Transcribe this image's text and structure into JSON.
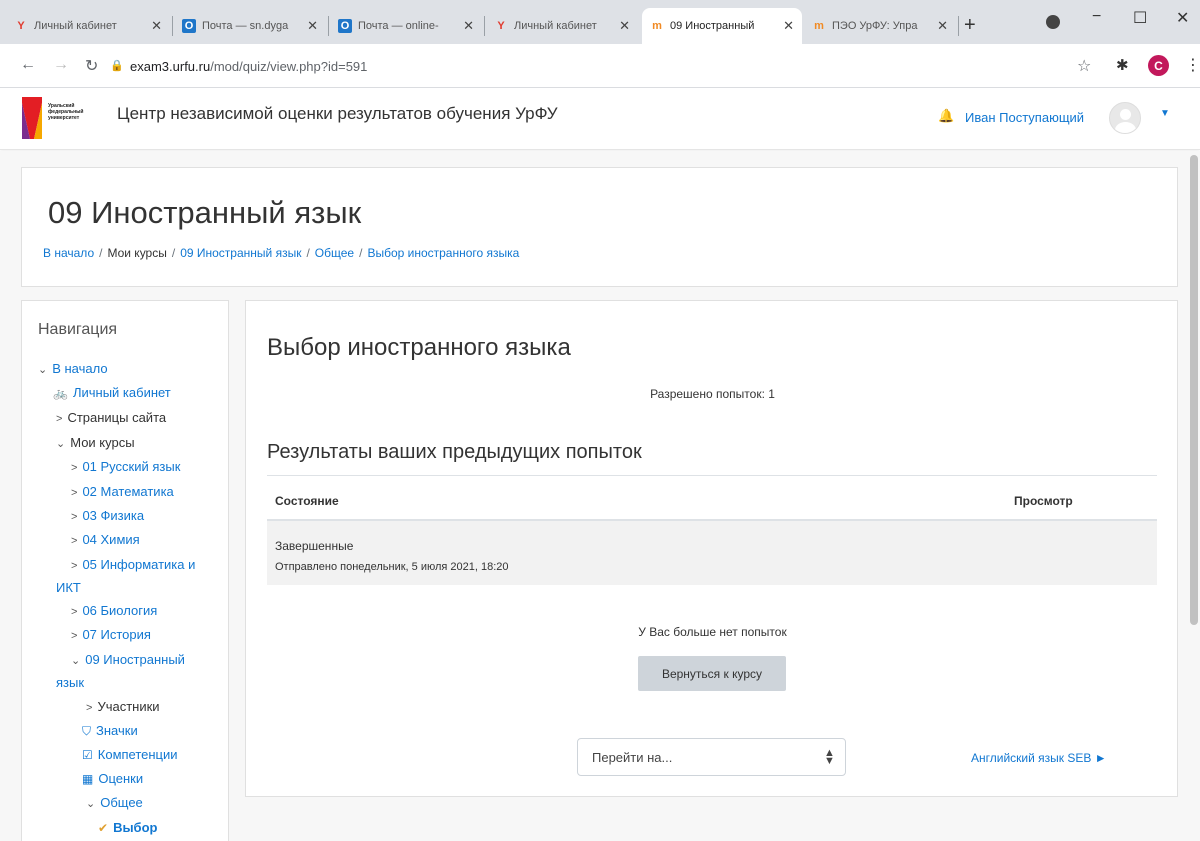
{
  "browser": {
    "tabs": [
      {
        "title": "Личный кабинет",
        "favicon": "yandex-icon"
      },
      {
        "title": "Почта — sn.dyga",
        "favicon": "outlook-icon"
      },
      {
        "title": "Почта — online-",
        "favicon": "outlook-icon"
      },
      {
        "title": "Личный кабинет",
        "favicon": "yandex-icon"
      },
      {
        "title": "09 Иностранный",
        "favicon": "moodle-icon",
        "active": true
      },
      {
        "title": "ПЭО УрФУ: Упра",
        "favicon": "moodle-icon"
      }
    ],
    "new_tab": "+",
    "url_host": "exam3.urfu.ru",
    "url_path": "/mod/quiz/view.php?id=591",
    "profile_letter": "C",
    "window_controls": {
      "minimize": "−",
      "maximize": "☐",
      "close": "✕"
    }
  },
  "site": {
    "logo_text": [
      "Уральский",
      "федеральный",
      "университет"
    ],
    "title": "Центр независимой оценки результатов обучения УрФУ",
    "user_name": "Иван Поступающий"
  },
  "course": {
    "title": "09 Иностранный язык",
    "breadcrumb": [
      "В начало",
      "Мои курсы",
      "09 Иностранный язык",
      "Общее",
      "Выбор иностранного языка"
    ]
  },
  "navigation": {
    "title": "Навигация",
    "items": [
      {
        "label": "В начало",
        "chevron": "⌄"
      },
      {
        "label": "Личный кабинет",
        "icon": "dashboard-icon"
      },
      {
        "label": "Страницы сайта",
        "chevron": ">"
      },
      {
        "label": "Мои курсы",
        "chevron": "⌄"
      },
      {
        "label": "01 Русский язык",
        "chevron": ">"
      },
      {
        "label": "02 Математика",
        "chevron": ">"
      },
      {
        "label": "03 Физика",
        "chevron": ">"
      },
      {
        "label": "04 Химия",
        "chevron": ">"
      },
      {
        "label": "05 Информатика и ИКТ",
        "chevron": ">"
      },
      {
        "label": "06 Биология",
        "chevron": ">"
      },
      {
        "label": "07 История",
        "chevron": ">"
      },
      {
        "label": "09 Иностранный язык",
        "chevron": "⌄"
      },
      {
        "label": "Участники",
        "chevron": ">"
      },
      {
        "label": "Значки",
        "icon": "shield-icon"
      },
      {
        "label": "Компетенции",
        "icon": "checkbox-icon"
      },
      {
        "label": "Оценки",
        "icon": "table-icon"
      },
      {
        "label": "Общее",
        "chevron": "⌄"
      },
      {
        "label": "Выбор",
        "icon": "quiz-icon"
      }
    ]
  },
  "quiz": {
    "title": "Выбор иностранного языка",
    "attempts_allowed": "Разрешено попыток: 1",
    "results_title": "Результаты ваших предыдущих попыток",
    "table": {
      "headers": {
        "state": "Состояние",
        "review": "Просмотр"
      },
      "rows": [
        {
          "state": "Завершенные",
          "submitted": "Отправлено понедельник, 5 июля 2021, 18:20"
        }
      ]
    },
    "no_more_attempts": "У Вас больше нет попыток",
    "back_button": "Вернуться к курсу",
    "jump_select": "Перейти на...",
    "next_activity": "Английский язык SEB ►"
  },
  "colors": {
    "link": "#1177d1",
    "button": "#ced4da",
    "row_bg": "#f2f2f2"
  }
}
